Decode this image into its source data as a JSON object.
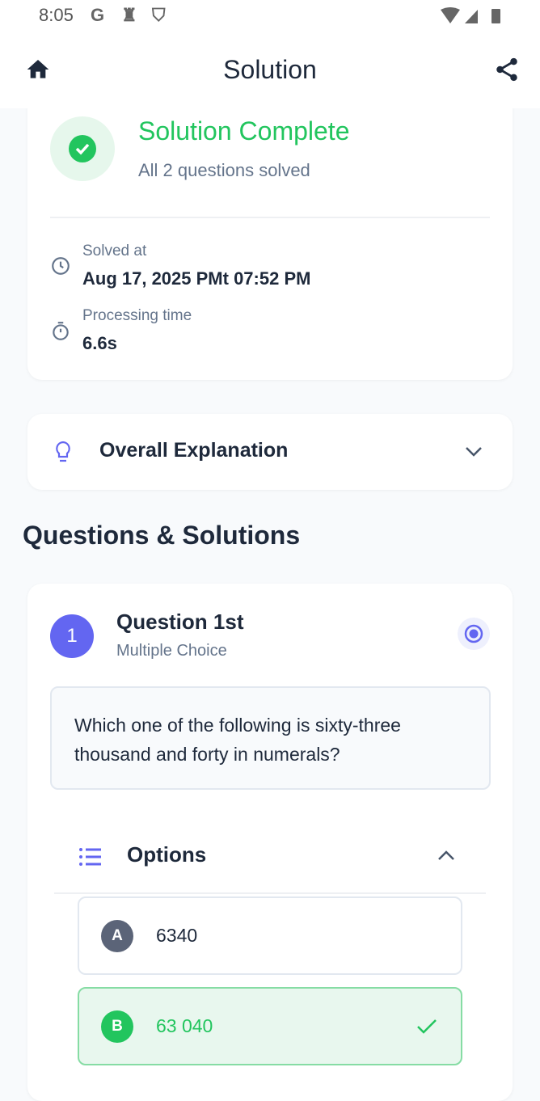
{
  "status_bar": {
    "time": "8:05",
    "icons": [
      "google-icon",
      "keyhole-icon",
      "shield-icon",
      "wifi-icon",
      "signal-icon",
      "battery-icon"
    ]
  },
  "app_bar": {
    "title": "Solution",
    "left_icon": "home-icon",
    "right_icon": "share-icon"
  },
  "summary": {
    "title": "Solution Complete",
    "subtitle": "All 2 questions solved",
    "solved_at_label": "Solved at",
    "solved_at": "Aug 17, 2025 PMt 07:52 PM",
    "processing_label": "Processing time",
    "processing_time": "6.6s"
  },
  "explanation": {
    "title": "Overall Explanation"
  },
  "section_title": "Questions & Solutions",
  "question": {
    "number": "1",
    "title": "Question 1st",
    "type": "Multiple Choice",
    "text": "Which one of the following is sixty-three thousand and forty in numerals?",
    "options_title": "Options",
    "options": [
      {
        "letter": "A",
        "value": "6340",
        "correct": false
      },
      {
        "letter": "B",
        "value": "63 040",
        "correct": true
      }
    ]
  },
  "colors": {
    "success": "#22c55e",
    "accent": "#6366f1",
    "text": "#1e293b",
    "muted": "#64748b"
  }
}
